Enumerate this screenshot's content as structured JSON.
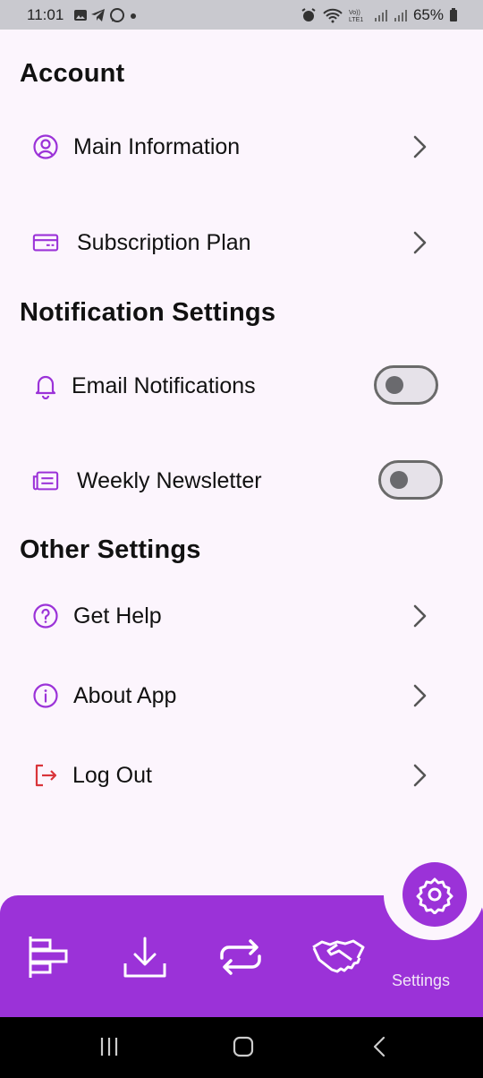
{
  "status_bar": {
    "time": "11:01",
    "battery": "65%",
    "left_icons": [
      "gallery-icon",
      "telegram-icon",
      "whatsapp-icon",
      "dot-icon"
    ],
    "right_icons": [
      "alarm-icon",
      "wifi-icon",
      "volte-icon",
      "signal-icon",
      "signal-icon",
      "battery-icon"
    ]
  },
  "sections": {
    "account": "Account",
    "notifications": "Notification Settings",
    "other": "Other Settings"
  },
  "items": {
    "main_info": "Main Information",
    "subscription": "Subscription Plan",
    "email_notifications": "Email Notifications",
    "weekly_newsletter": "Weekly Newsletter",
    "get_help": "Get Help",
    "about_app": "About App",
    "log_out": "Log Out"
  },
  "toggles": {
    "email_notifications": false,
    "weekly_newsletter": false
  },
  "bottom_nav": {
    "items": [
      "chart-icon",
      "download-icon",
      "repeat-icon",
      "handshake-icon",
      "settings-icon"
    ],
    "active_label": "Settings"
  },
  "colors": {
    "accent": "#9b32d8",
    "background": "#fcf5fd",
    "logout_icon": "#d9343a"
  }
}
